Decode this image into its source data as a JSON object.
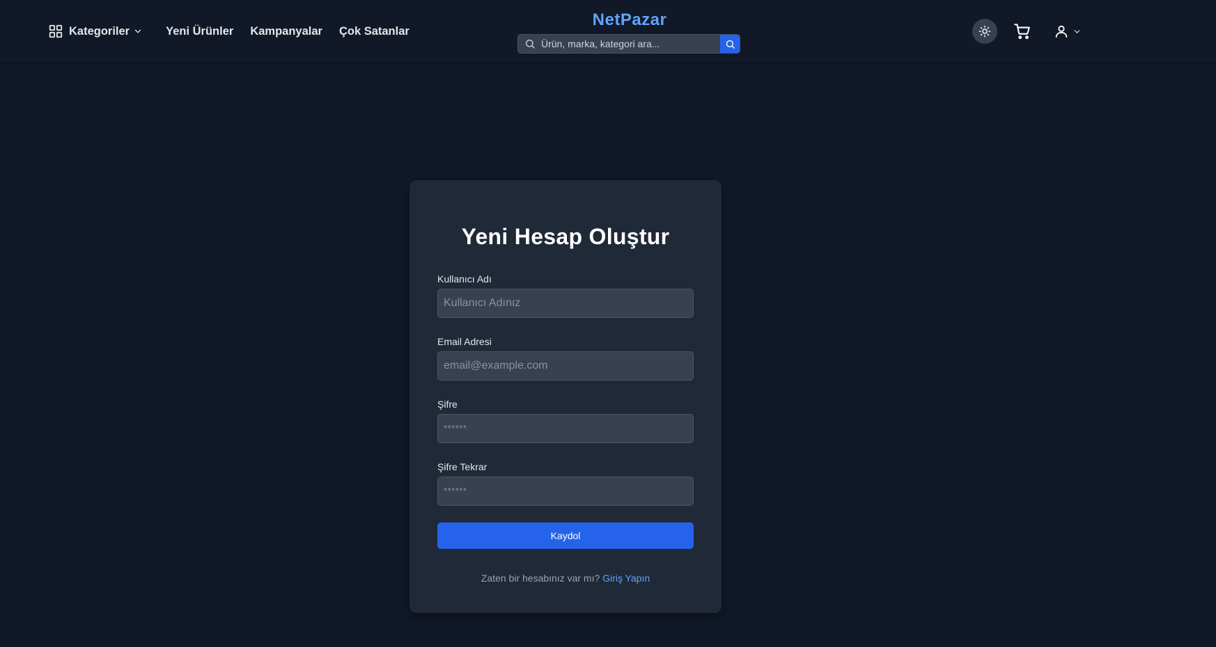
{
  "header": {
    "brand": "NetPazar",
    "categories_label": "Kategoriler",
    "nav_links": [
      "Yeni Ürünler",
      "Kampanyalar",
      "Çok Satanlar"
    ],
    "search_placeholder": "Ürün, marka, kategori ara...",
    "icons": {
      "categories": "grid-icon",
      "dropdown": "chevron-down-icon",
      "search": "search-icon",
      "theme": "sun-icon",
      "cart": "cart-icon",
      "user": "user-icon"
    }
  },
  "register_form": {
    "title": "Yeni Hesap Oluştur",
    "fields": [
      {
        "label": "Kullanıcı Adı",
        "placeholder": "Kullanıcı Adınız",
        "value": ""
      },
      {
        "label": "Email Adresi",
        "placeholder": "email@example.com",
        "value": ""
      },
      {
        "label": "Şifre",
        "placeholder": "******",
        "value": ""
      },
      {
        "label": "Şifre Tekrar",
        "placeholder": "******",
        "value": ""
      }
    ],
    "submit_label": "Kaydol",
    "login_prompt": "Zaten bir hesabınız var mı?",
    "login_link": "Giriş Yapın"
  },
  "colors": {
    "page_background": "#111827",
    "card_background": "#1f2937",
    "input_background": "#374151",
    "accent": "#2563eb",
    "brand": "#60a5fa"
  }
}
